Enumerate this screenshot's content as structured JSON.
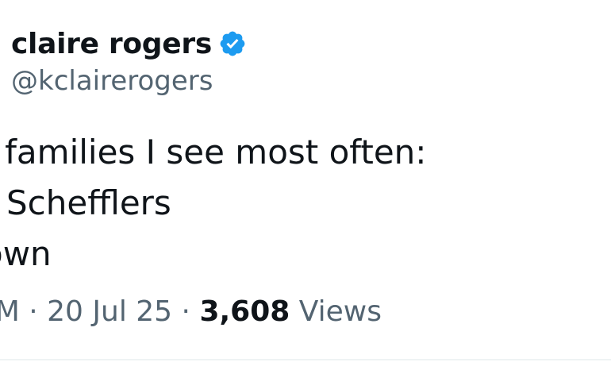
{
  "author": {
    "display_name": "claire rogers",
    "handle": "@kclairerogers",
    "verified_icon": "verified-badge-icon",
    "verified_color": "#1d9bf0"
  },
  "tweet": {
    "lines": [
      "f families I see most often:",
      "Schefflers",
      "own"
    ]
  },
  "meta": {
    "time": "PM",
    "separator": "·",
    "date": "20 Jul 25",
    "views_count": "3,608",
    "views_label": "Views"
  },
  "colors": {
    "text": "#0f1419",
    "secondary": "#536471",
    "divider": "#eff3f4"
  }
}
